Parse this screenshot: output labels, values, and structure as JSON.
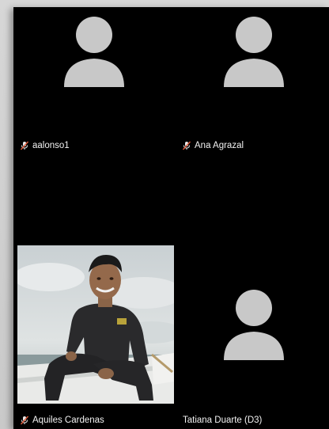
{
  "participants": [
    {
      "name": "aalonso1",
      "muted": true,
      "video": false,
      "avatar_icon": "person-placeholder-icon"
    },
    {
      "name": "Ana Agrazal",
      "muted": true,
      "video": false,
      "avatar_icon": "person-placeholder-icon"
    },
    {
      "name": "Aquiles Cardenas",
      "muted": true,
      "video": true,
      "avatar_icon": "participant-video-feed"
    },
    {
      "name": "Tatiana Duarte (D3)",
      "muted": false,
      "video": false,
      "avatar_icon": "person-placeholder-icon"
    }
  ],
  "colors": {
    "background": "#000000",
    "avatar": "#c8c8c8",
    "label_text": "#f2f2f2",
    "muted_mic": "#e05a3a"
  }
}
